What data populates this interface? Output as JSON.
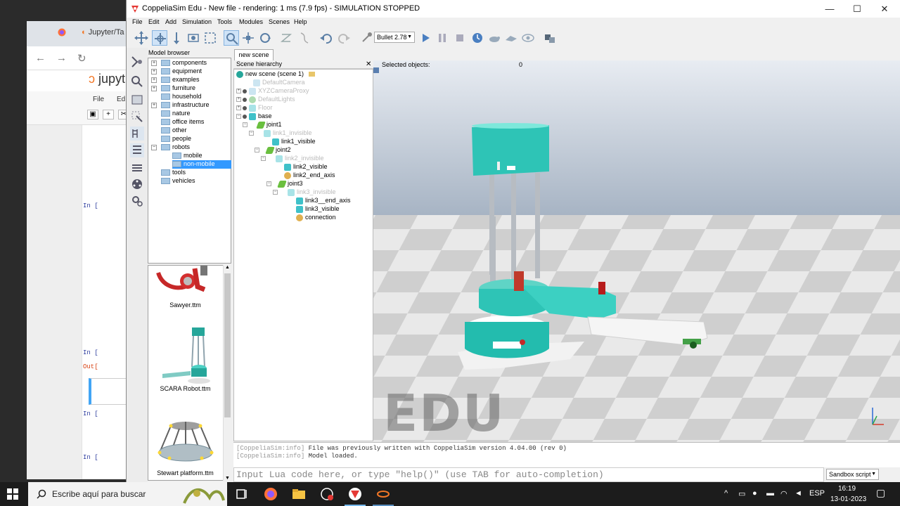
{
  "background_browser": {
    "tab_label": "Jupyter/Ta",
    "app_name": "jupyt",
    "menu": [
      "File",
      "Ed"
    ],
    "prompts": [
      {
        "text": "In [",
        "kind": "in"
      },
      {
        "text": "In [",
        "kind": "in"
      },
      {
        "text": "Out[",
        "kind": "out"
      },
      {
        "text": "In [",
        "kind": "in"
      },
      {
        "text": "In [",
        "kind": "in"
      }
    ]
  },
  "window": {
    "title": "CoppeliaSim Edu - New file - rendering: 1 ms (7.9 fps) - SIMULATION STOPPED",
    "controls": {
      "minimize": "—",
      "maximize": "☐",
      "close": "✕"
    }
  },
  "menubar": [
    "File",
    "Edit",
    "Add",
    "Simulation",
    "Tools",
    "Modules",
    "Scenes",
    "Help"
  ],
  "toolbar": {
    "physics_engine": "Bullet 2.78"
  },
  "model_browser": {
    "header": "Model browser",
    "items": [
      {
        "label": "components",
        "expander": "+"
      },
      {
        "label": "equipment",
        "expander": "+"
      },
      {
        "label": "examples",
        "expander": "+"
      },
      {
        "label": "furniture",
        "expander": "+"
      },
      {
        "label": "household",
        "expander": ""
      },
      {
        "label": "infrastructure",
        "expander": "+"
      },
      {
        "label": "nature",
        "expander": ""
      },
      {
        "label": "office items",
        "expander": ""
      },
      {
        "label": "other",
        "expander": ""
      },
      {
        "label": "people",
        "expander": ""
      },
      {
        "label": "robots",
        "expander": "−"
      },
      {
        "label": "mobile",
        "expander": "",
        "child": true
      },
      {
        "label": "non-mobile",
        "expander": "",
        "child": true,
        "selected": true
      },
      {
        "label": "tools",
        "expander": ""
      },
      {
        "label": "vehicles",
        "expander": ""
      }
    ],
    "thumbnails": [
      "Sawyer.ttm",
      "SCARA Robot.ttm",
      "Stewart platform.ttm"
    ]
  },
  "scene_tab": "new scene",
  "scene_hierarchy": {
    "header": "Scene hierarchy",
    "close": "✕",
    "items": [
      {
        "label": "new scene (scene 1)",
        "level": 0,
        "icon": "scene",
        "dim": false
      },
      {
        "label": "DefaultCamera",
        "level": 1,
        "icon": "cam",
        "dim": true
      },
      {
        "label": "XYZCameraProxy",
        "level": 1,
        "icon": "cam",
        "dim": true
      },
      {
        "label": "DefaultLights",
        "level": 1,
        "icon": "light",
        "dim": true
      },
      {
        "label": "Floor",
        "level": 1,
        "icon": "shape",
        "dim": true
      },
      {
        "label": "base",
        "level": 1,
        "icon": "shape",
        "dim": false
      },
      {
        "label": "joint1",
        "level": 2,
        "icon": "joint",
        "dim": false
      },
      {
        "label": "link1_invisible",
        "level": 3,
        "icon": "shape",
        "dim": true
      },
      {
        "label": "link1_visible",
        "level": 4,
        "icon": "shape",
        "dim": false
      },
      {
        "label": "joint2",
        "level": 4,
        "icon": "joint",
        "dim": false
      },
      {
        "label": "link2_invisible",
        "level": 5,
        "icon": "shape",
        "dim": true
      },
      {
        "label": "link2_visible",
        "level": 6,
        "icon": "shape",
        "dim": false
      },
      {
        "label": "link2_end_axis",
        "level": 6,
        "icon": "dummy",
        "dim": false
      },
      {
        "label": "joint3",
        "level": 6,
        "icon": "joint",
        "dim": false
      },
      {
        "label": "link3_invisible",
        "level": 7,
        "icon": "shape",
        "dim": true
      },
      {
        "label": "link3__end_axis",
        "level": 8,
        "icon": "shape",
        "dim": false
      },
      {
        "label": "link3_visible",
        "level": 8,
        "icon": "shape",
        "dim": false
      },
      {
        "label": "connection",
        "level": 8,
        "icon": "dummy",
        "dim": false
      }
    ]
  },
  "viewport": {
    "selected_label": "Selected objects:",
    "selected_count": "0",
    "watermark": "EDU"
  },
  "console": {
    "lines": [
      {
        "tag": "[CoppeliaSim:info]",
        "text": "File was previously written with CoppeliaSim version 4.04.00 (rev 0)"
      },
      {
        "tag": "[CoppeliaSim:info]",
        "text": "Model loaded."
      }
    ],
    "input_placeholder": "Input Lua code here, or type \"help()\" (use TAB for auto-completion)",
    "script_selector": "Sandbox script"
  },
  "taskbar": {
    "search_placeholder": "Escribe aquí para buscar",
    "language": "ESP",
    "time": "16:19",
    "date": "13-01-2023"
  }
}
